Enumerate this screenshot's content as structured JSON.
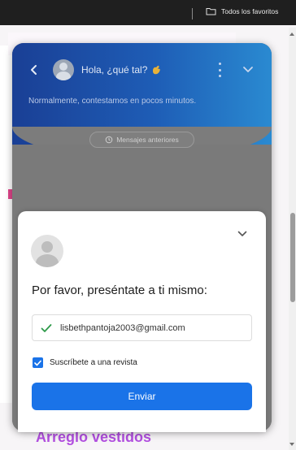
{
  "browser": {
    "bookmark_folder_label": "Todos los favoritos"
  },
  "page": {
    "heading": "Arreglo vestidos"
  },
  "chat": {
    "greeting": "Hola, ¿qué tal?",
    "response_note": "Normalmente, contestamos en pocos minutos.",
    "previous_messages_label": "Mensajes anteriores",
    "accent_color": "#1a73e8"
  },
  "form": {
    "title": "Por favor, preséntate a ti mismo:",
    "email_value": "lisbethpantoja2003@gmail.com",
    "subscribe_label": "Suscríbete a una revista",
    "subscribe_checked": true,
    "submit_label": "Enviar"
  }
}
